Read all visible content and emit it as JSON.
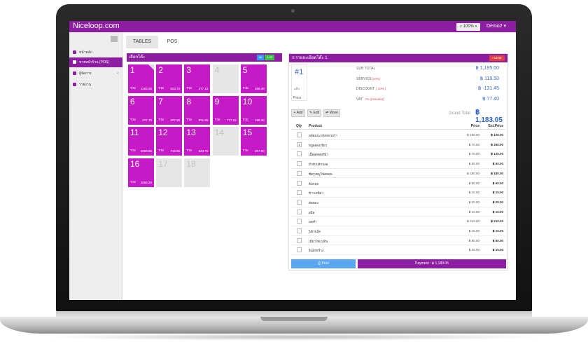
{
  "app": {
    "brand": "Niceloop.com",
    "zoom": "100%",
    "user": "Demo2"
  },
  "sidebar": {
    "items": [
      {
        "label": "หน้าหลัก",
        "icon": "home-icon"
      },
      {
        "label": "ขายหน้าร้าน (POS)",
        "icon": "cutlery-icon",
        "active": true
      },
      {
        "label": "ผู้จัดการ",
        "icon": "user-icon",
        "chevron": "‹"
      },
      {
        "label": "รายงาน",
        "icon": "report-icon"
      }
    ]
  },
  "tabs": [
    {
      "label": "TABLES",
      "active": true
    },
    {
      "label": "POS",
      "active": false
    }
  ],
  "tables": {
    "title": "เลือกโต๊ะ",
    "all_label": "All",
    "range_label": "1-20",
    "items": [
      {
        "num": "1",
        "lbl": "รวม",
        "total": "1183.05",
        "occupied": true,
        "corner": true
      },
      {
        "num": "2",
        "lbl": "รวม",
        "total": "623.70",
        "occupied": true
      },
      {
        "num": "3",
        "lbl": "รวม",
        "total": "277.15",
        "occupied": true
      },
      {
        "num": "4",
        "lbl": "",
        "total": "",
        "occupied": false
      },
      {
        "num": "5",
        "lbl": "รวม",
        "total": "356.40",
        "occupied": true
      },
      {
        "num": "6",
        "lbl": "รวม",
        "total": "227.70",
        "occupied": true
      },
      {
        "num": "7",
        "lbl": "รวม",
        "total": "207.90",
        "occupied": true
      },
      {
        "num": "8",
        "lbl": "รวม",
        "total": "831.60",
        "occupied": true
      },
      {
        "num": "9",
        "lbl": "รวม",
        "total": "777.15",
        "occupied": true
      },
      {
        "num": "10",
        "lbl": "รวม",
        "total": "168.30",
        "occupied": true
      },
      {
        "num": "11",
        "lbl": "รวม",
        "total": "1009.80",
        "occupied": true
      },
      {
        "num": "12",
        "lbl": "รวม",
        "total": "712.80",
        "occupied": true
      },
      {
        "num": "13",
        "lbl": "รวม",
        "total": "623.70",
        "occupied": true
      },
      {
        "num": "14",
        "lbl": "",
        "total": "",
        "occupied": false
      },
      {
        "num": "15",
        "lbl": "รวม",
        "total": "297.00",
        "occupied": true
      },
      {
        "num": "16",
        "lbl": "รวม",
        "total": "1069.20",
        "occupied": true
      },
      {
        "num": "17",
        "lbl": "",
        "total": "",
        "occupied": false
      },
      {
        "num": "18",
        "lbl": "",
        "total": "",
        "occupied": false
      }
    ]
  },
  "order": {
    "title": "≡ รายละเอียดโต๊ะ 1",
    "clear_label": "Clear",
    "number": "#1",
    "number_sub": "แท็บ",
    "price_tab": "Price",
    "subtotal_label": "SUB TOTAL",
    "subtotal": "฿ 1,195.00",
    "service_label": "SERVICE",
    "service_note": "(10%)",
    "service": "฿ 119.50",
    "discount_label": "DISCOUNT",
    "discount_note": "( 10% )",
    "discount": "฿ -131.45",
    "vat_label": "VAT",
    "vat_note": "7% (Included)",
    "vat": "฿ 77.40",
    "grand_label": "Grand Total",
    "grand": "฿ 1,183.05",
    "add_label": "+ Add",
    "edit_label": "Edit",
    "move_label": "Move",
    "col_qty": "Qty",
    "col_product": "Product",
    "col_price": "Price",
    "col_ext": "Ext.Price",
    "rows": [
      {
        "qty": "",
        "product": "ลดัดมปะหรดหยวยรา",
        "price": "฿ 100.00",
        "ext": "฿ 100.00"
      },
      {
        "qty": "4",
        "product": "หมูผดผงเขียว",
        "price": "฿ 70.00",
        "ext": "฿ 280.00"
      },
      {
        "qty": "",
        "product": "เนื้ออดดดเรียว",
        "price": "฿ 70.00",
        "ext": "฿ 140.00"
      },
      {
        "qty": "",
        "product": "ยำสัปปลักปลอ",
        "price": "฿ 60.00",
        "ext": "฿ 60.00"
      },
      {
        "qty": "",
        "product": "ซี่ครูงหมูโน้ตหยุน",
        "price": "฿ 180.00",
        "ext": "฿ 180.00"
      },
      {
        "qty": "",
        "product": "ต้มจฤย",
        "price": "฿ 60.00",
        "ext": "฿ 60.00"
      },
      {
        "qty": "",
        "product": "ข้าวเหนียว",
        "price": "฿ 15.00",
        "ext": "฿ 15.00"
      },
      {
        "qty": "",
        "product": "ตัดตอง",
        "price": "฿ 20.00",
        "ext": "฿ 20.00"
      },
      {
        "qty": "",
        "product": "ผมิล",
        "price": "฿ 10.00",
        "ext": "฿ 10.00"
      },
      {
        "qty": "",
        "product": "มดหำ",
        "price": "฿ 210.00",
        "ext": "฿ 210.00"
      },
      {
        "qty": "",
        "product": "ไส้กรเล็ก",
        "price": "฿ 15.00",
        "ext": "฿ 15.00"
      },
      {
        "qty": "",
        "product": "เมี่ยวโซแนทิน",
        "price": "฿ 80.00",
        "ext": "฿ 80.00"
      },
      {
        "qty": "",
        "product": "จินดรทร้าง",
        "price": "฿ 25.00",
        "ext": "฿ 25.00"
      }
    ],
    "print_label": "Print",
    "payment_label": "Payment :",
    "payment_value": "฿ 1,183.05"
  }
}
